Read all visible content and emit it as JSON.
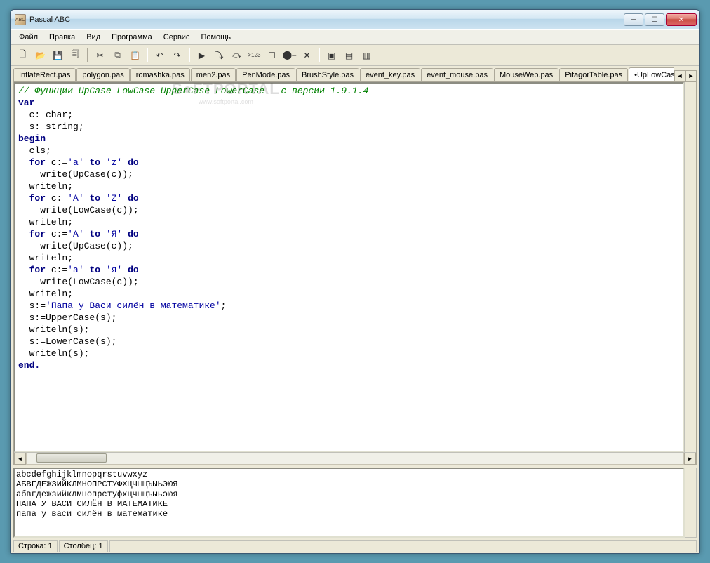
{
  "window": {
    "title": "Pascal ABC"
  },
  "menu": {
    "file": "Файл",
    "edit": "Правка",
    "view": "Вид",
    "program": "Программа",
    "service": "Сервис",
    "help": "Помощь"
  },
  "toolbar_icons": {
    "new": "🗋",
    "open": "📂",
    "save": "💾",
    "saveall": "🗐",
    "cut": "✂",
    "copy": "⧉",
    "paste": "📋",
    "undo": "↶",
    "redo": "↷",
    "run": "▶",
    "stepinto": "⤵",
    "stepover": "⤼",
    "trace": ">123",
    "stop": "☐",
    "breakpoint": "⬤⎯",
    "clearbp": "✕",
    "win1": "▣",
    "win2": "▤",
    "win3": "▥"
  },
  "tabs": [
    "InflateRect.pas",
    "polygon.pas",
    "romashka.pas",
    "men2.pas",
    "PenMode.pas",
    "BrushStyle.pas",
    "event_key.pas",
    "event_mouse.pas",
    "MouseWeb.pas",
    "PifagorTable.pas",
    "•UpLowCase.pas"
  ],
  "active_tab_index": 10,
  "code": {
    "comment": "// Функции UpCase LowCase UpperCase LowerCase - с версии 1.9.1.4",
    "var": "var",
    "decl_c": "  c: char;",
    "decl_s": "  s: string;",
    "begin": "begin",
    "cls": "  cls;",
    "loops": [
      {
        "for": "  for",
        "expr": " c:=",
        "q1": "'a'",
        "to": " to ",
        "q2": "'z'",
        "do": " do",
        "body": "    write(UpCase(c));",
        "wl": "  writeln;"
      },
      {
        "for": "  for",
        "expr": " c:=",
        "q1": "'A'",
        "to": " to ",
        "q2": "'Z'",
        "do": " do",
        "body": "    write(LowCase(c));",
        "wl": "  writeln;"
      },
      {
        "for": "  for",
        "expr": " c:=",
        "q1": "'А'",
        "to": " to ",
        "q2": "'Я'",
        "do": " do",
        "body": "    write(UpCase(c));",
        "wl": "  writeln;"
      },
      {
        "for": "  for",
        "expr": " c:=",
        "q1": "'а'",
        "to": " to ",
        "q2": "'я'",
        "do": " do",
        "body": "    write(LowCase(c));",
        "wl": "  writeln;"
      }
    ],
    "s_assign_pre": "  s:=",
    "s_literal": "'Папа у Васи силён в математике'",
    "s_assign_post": ";",
    "upper": "  s:=UpperCase(s);",
    "wls1": "  writeln(s);",
    "lower": "  s:=LowerCase(s);",
    "wls2": "  writeln(s);",
    "end": "end."
  },
  "output": [
    "abcdefghijklmnopqrstuvwxyz",
    "АБВГДЕЖЗИЙКЛМНОПРСТУФХЦЧШЩЪЫЬЭЮЯ",
    "абвгдежзийклмнопрстуфхцчшщъыьэюя",
    "ПАПА У ВАСИ СИЛЁН В МАТЕМАТИКЕ",
    "папа у васи силён в математике"
  ],
  "status": {
    "row": "Строка: 1",
    "col": "Столбец: 1"
  },
  "watermark": {
    "big": "S●FTPORTAL",
    "small": "www.softportal.com"
  }
}
